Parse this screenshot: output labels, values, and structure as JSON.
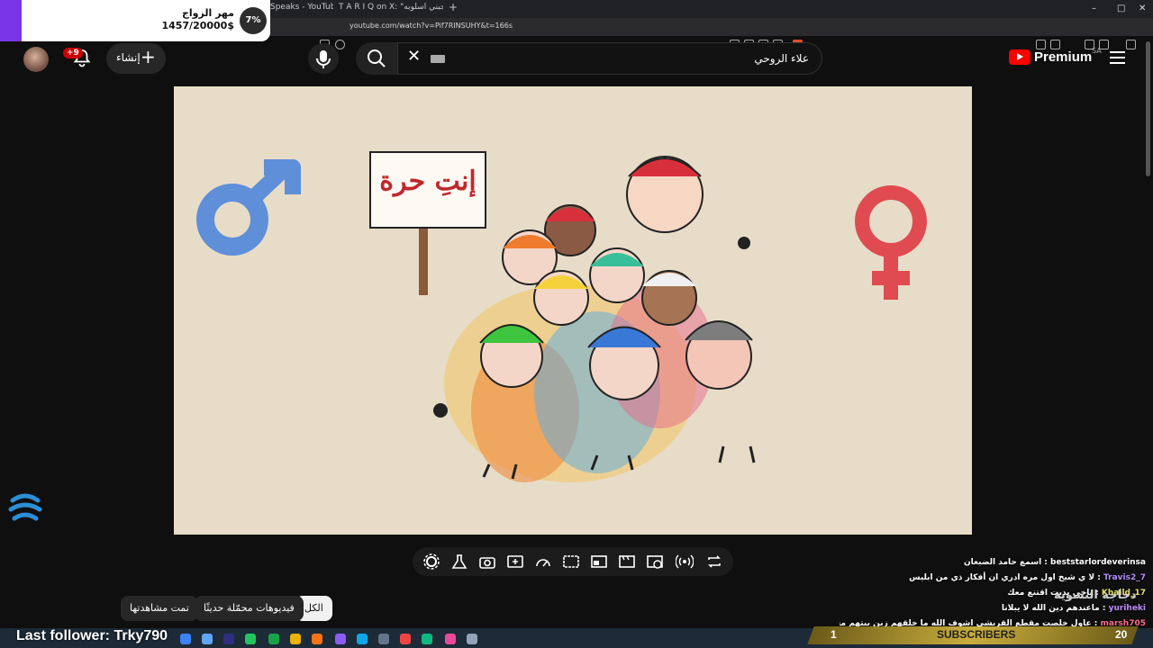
{
  "browser": {
    "tabs": [
      "Speaks - YouTube",
      "T A R I Q on X: \"والم يعجبني أسلوبه"
    ],
    "url": "youtube.com/watch?v=Pif7RINSUHY&t=166s",
    "new_tab": "+",
    "window_controls": [
      "–",
      "□",
      "✕"
    ]
  },
  "goal_widget": {
    "title": "مهر الزواج",
    "value": "1457/20000$",
    "percent": "7%",
    "accent_color": "#7b35e8"
  },
  "header": {
    "notification_badge": "+9",
    "create_label": "إنشاء",
    "search_query": "علاء الروحي",
    "logo_text": "Premium",
    "logo_region": "SA",
    "brand_color": "#ff0000"
  },
  "video": {
    "sign_text": "إنتِ حرة"
  },
  "player_controls": [
    "settings-icon",
    "lab-icon",
    "camera-icon",
    "add-icon",
    "speed-icon",
    "subtitles-icon",
    "miniplayer-icon",
    "theater-icon",
    "cast-icon",
    "live-icon",
    "loop-icon"
  ],
  "chips": [
    "الكل",
    "فيديوهات محمّلة حديثًا",
    "تمت مشاهدتها"
  ],
  "chat": [
    {
      "user": "beststarlordeverinsa",
      "text": "اسمع حامد الضبعان"
    },
    {
      "user": "Travis2_7",
      "text": "لا ي شيخ اول مره ادري ان أفكار ذي من ابليس"
    },
    {
      "user": "Khaild_17",
      "text": "ياخي بديت اقتنع معك"
    },
    {
      "user": "yuriheki",
      "text": "ماعندهم دين الله لا يبلانا"
    },
    {
      "user": "marsh705",
      "text": "عاول خلصت مقطع القريشي اشوف الله ما خلقهم زين بيتهم مقطع ثاني"
    },
    {
      "user": "jwer",
      "text": "الحركة النسوية ولد عمي يشتغل فيها"
    }
  ],
  "channel_overlay": "دجاجة النسوية",
  "stream_overlay": {
    "last_follower": "Last follower: Trky790",
    "subs_label": "SUBSCRIBERS",
    "subs_current": "1",
    "subs_goal": "20"
  }
}
